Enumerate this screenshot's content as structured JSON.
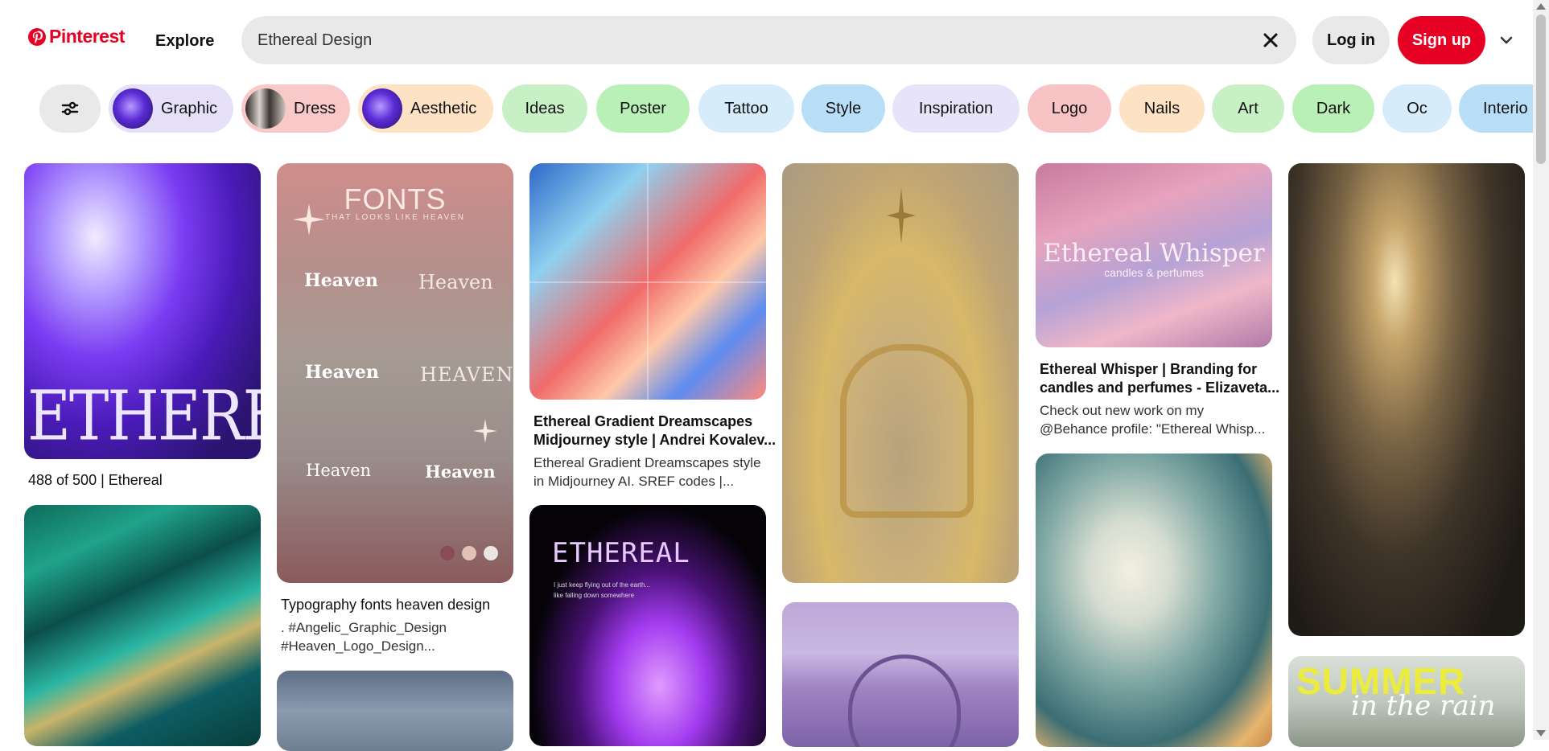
{
  "header": {
    "logo_text": "Pinterest",
    "explore_label": "Explore",
    "search_value": "Ethereal Design",
    "login_label": "Log in",
    "signup_label": "Sign up",
    "brand_color": "#e60023"
  },
  "filters": {
    "chips": [
      {
        "label": "Graphic",
        "bg": "#e5e0f7",
        "thumb": "#6a3fd1"
      },
      {
        "label": "Dress",
        "bg": "#f9c9c9",
        "thumb": "#3b3633"
      },
      {
        "label": "Aesthetic",
        "bg": "#fde2c4",
        "thumb": "#6a3fd1"
      },
      {
        "label": "Ideas",
        "bg": "#c7f0c4"
      },
      {
        "label": "Poster",
        "bg": "#b9f0b5"
      },
      {
        "label": "Tattoo",
        "bg": "#d7ecfb"
      },
      {
        "label": "Style",
        "bg": "#b8def8"
      },
      {
        "label": "Inspiration",
        "bg": "#e7e3f8"
      },
      {
        "label": "Logo",
        "bg": "#f7c3c5"
      },
      {
        "label": "Nails",
        "bg": "#fde2c4"
      },
      {
        "label": "Art",
        "bg": "#c7f0c4"
      },
      {
        "label": "Dark",
        "bg": "#b9f0b5"
      },
      {
        "label": "Oc",
        "bg": "#d7ecfb"
      },
      {
        "label": "Interio",
        "bg": "#b8def8"
      }
    ]
  },
  "pins": [
    {
      "title": "488 of 500 | Ethereal",
      "overlay": "ETHEREAL"
    },
    {
      "title": "Typography fonts heaven design",
      "desc1": ". #Angelic_Graphic_Design",
      "desc2": "#Heaven_Logo_Design...",
      "overlay_title": "FONTS",
      "overlay_sub": "THAT LOOKS LIKE HEAVEN",
      "words": [
        "Heaven",
        "Heaven",
        "Heaven",
        "HEAVEN",
        "Heaven",
        "Heaven"
      ]
    },
    {
      "title1": "Ethereal Gradient Dreamscapes",
      "title2": "Midjourney style | Andrei Kovalev...",
      "desc1": "Ethereal Gradient Dreamscapes style",
      "desc2": "in Midjourney AI. SREF codes |..."
    },
    {
      "title1": "Ethereal Whisper | Branding for",
      "title2": "candles and perfumes - Elizaveta...",
      "desc1": "Check out new work on my",
      "desc2": "@Behance profile: \"Ethereal Whisp...",
      "overlay_title": "Ethereal Whisper",
      "overlay_sub": "candles & perfumes"
    },
    {
      "overlay": "ETHEREAL",
      "line1": "I just keep flying out of the earth...",
      "line2": "like falling down somewhere"
    },
    {
      "overlay_title": "SUMMER",
      "overlay_sub": "in the rain"
    }
  ]
}
